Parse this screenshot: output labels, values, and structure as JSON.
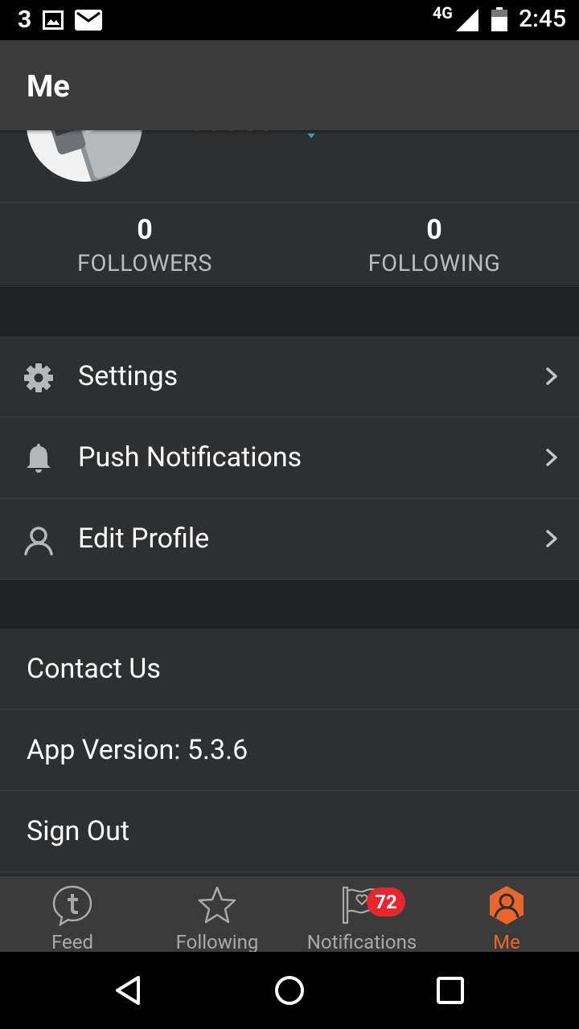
{
  "status_bar": {
    "notification_count": "3",
    "network": "4G",
    "time": "2:45"
  },
  "header": {
    "title": "Me"
  },
  "profile": {
    "username": "maddec"
  },
  "stats": {
    "followers": {
      "value": "0",
      "label": "FOLLOWERS"
    },
    "following": {
      "value": "0",
      "label": "FOLLOWING"
    }
  },
  "menu": {
    "settings": {
      "label": "Settings",
      "icon": "gear-icon"
    },
    "push_notifications": {
      "label": "Push Notifications",
      "icon": "bell-icon"
    },
    "edit_profile": {
      "label": "Edit Profile",
      "icon": "person-icon"
    }
  },
  "info": {
    "contact_us": "Contact Us",
    "app_version": "App Version: 5.3.6",
    "sign_out": "Sign Out"
  },
  "bottom_nav": {
    "feed": "Feed",
    "following": "Following",
    "notifications": "Notifications",
    "notifications_badge": "72",
    "me": "Me"
  },
  "colors": {
    "accent": "#e8652b",
    "badge": "#e8262c",
    "background": "#2d2f30",
    "header": "#3b3b3b"
  }
}
